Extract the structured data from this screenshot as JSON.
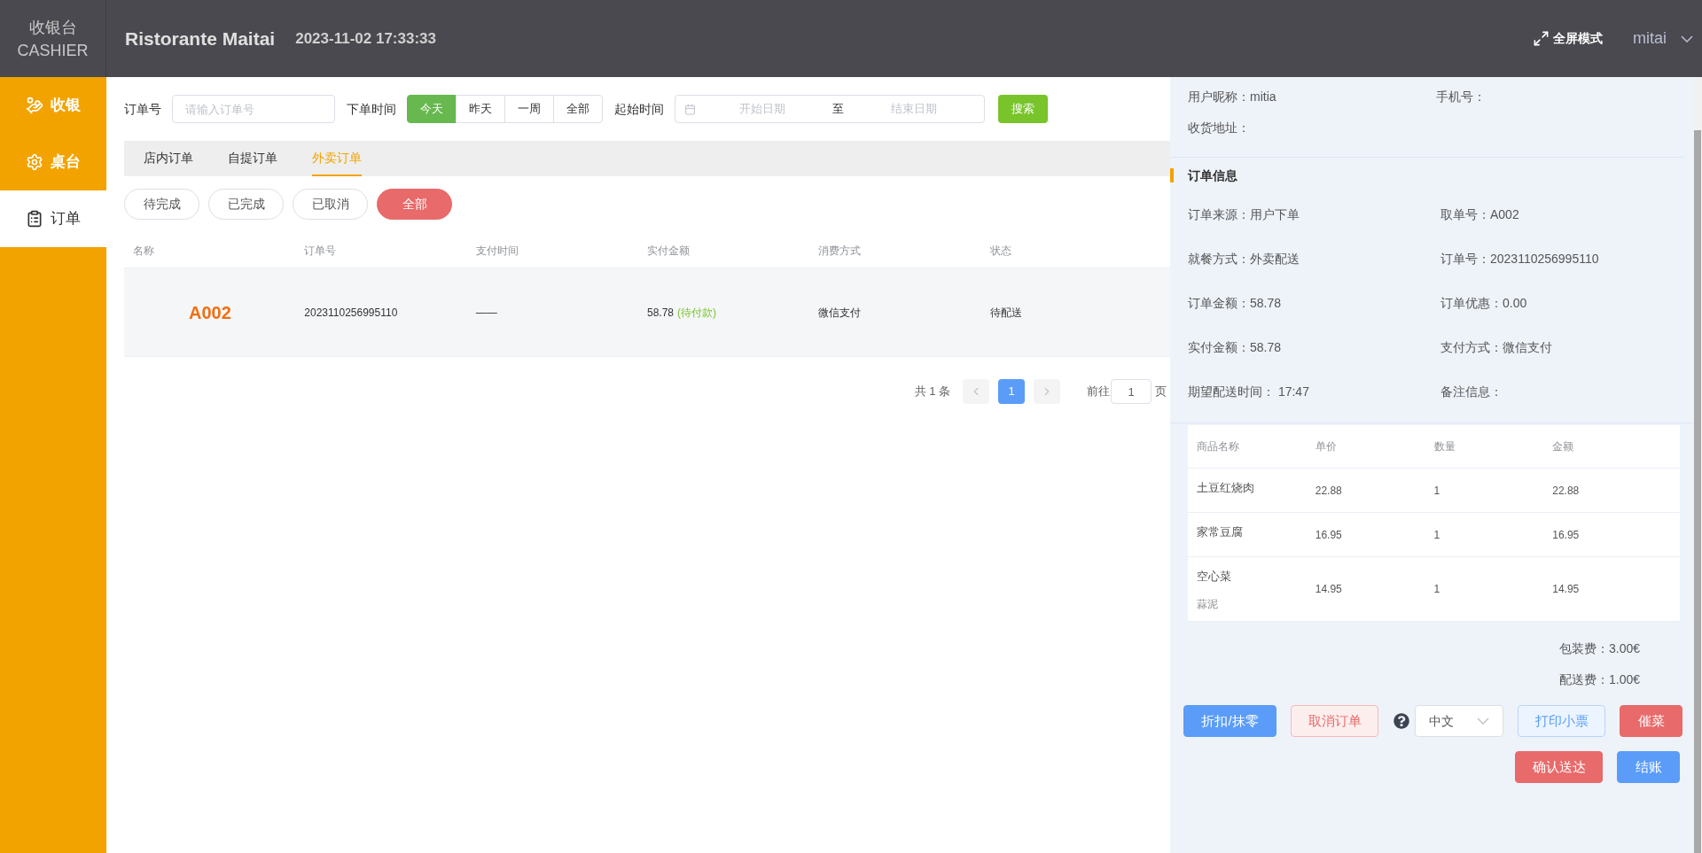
{
  "brand": {
    "title": "收银台",
    "subtitle": "CASHIER"
  },
  "header": {
    "restaurant": "Ristorante Maitai",
    "datetime": "2023-11-02 17:33:33",
    "fullscreen": "全屏模式",
    "user": "mitai"
  },
  "sidebar": {
    "items": [
      {
        "kind": "cash",
        "label": "收银",
        "selected": false
      },
      {
        "kind": "table",
        "label": "桌台",
        "selected": false
      },
      {
        "kind": "order",
        "label": "订单",
        "selected": true
      }
    ]
  },
  "filters": {
    "order_no_label": "订单号",
    "order_no_placeholder": "请输入订单号",
    "time_label": "下单时间",
    "time_options": [
      {
        "label": "今天",
        "selected": true
      },
      {
        "label": "昨天",
        "selected": false
      },
      {
        "label": "一周",
        "selected": false
      },
      {
        "label": "全部",
        "selected": false
      }
    ],
    "range_label": "起始时间",
    "start_placeholder": "开始日期",
    "range_separator": "至",
    "end_placeholder": "结束日期",
    "search": "搜索"
  },
  "tabs": [
    {
      "label": "店内订单",
      "selected": false
    },
    {
      "label": "自提订单",
      "selected": false
    },
    {
      "label": "外卖订单",
      "selected": true
    }
  ],
  "status_filters": [
    {
      "label": "待完成",
      "selected": false
    },
    {
      "label": "已完成",
      "selected": false
    },
    {
      "label": "已取消",
      "selected": false
    },
    {
      "label": "全部",
      "selected": true
    }
  ],
  "table": {
    "columns": [
      "名称",
      "订单号",
      "支付时间",
      "实付金额",
      "消费方式",
      "状态"
    ],
    "rows": [
      {
        "name": "A002",
        "order_no": "2023110256995110",
        "pay_time": "——",
        "amount": "58.78",
        "amount_note": "(待付款)",
        "method": "微信支付",
        "status": "待配送"
      }
    ]
  },
  "pagination": {
    "total": "共 1 条",
    "pages": [
      {
        "label": "1",
        "selected": true
      }
    ],
    "goto_label": "前往",
    "goto_value": "1",
    "page_suffix": "页"
  },
  "detail": {
    "customer": [
      {
        "label": "用户昵称：mitia"
      },
      {
        "label": "手机号："
      },
      {
        "label": "收货地址："
      }
    ],
    "section_title": "订单信息",
    "info": [
      "订单来源：用户下单",
      "取单号：A002",
      "就餐方式：外卖配送",
      "订单号：2023110256995110",
      "订单金额：58.78",
      "订单优惠：0.00",
      "实付金额：58.78",
      "支付方式：微信支付",
      "期望配送时间： 17:47",
      "备注信息："
    ],
    "items_table": {
      "columns": [
        "商品名称",
        "单价",
        "数量",
        "金额"
      ],
      "rows": [
        {
          "name": "土豆红烧肉",
          "price": "22.88",
          "qty": "1",
          "total": "22.88"
        },
        {
          "name": "家常豆腐",
          "price": "16.95",
          "qty": "1",
          "total": "16.95"
        },
        {
          "name": "空心菜",
          "note": "蒜泥",
          "price": "14.95",
          "qty": "1",
          "total": "14.95"
        }
      ]
    },
    "fees": [
      "包装费：3.00€",
      "配送费：1.00€"
    ],
    "language": "中文",
    "buttons": [
      {
        "label": "折扣/抹零",
        "kind": "primary"
      },
      {
        "label": "取消订单",
        "kind": "danger-plain"
      },
      {
        "label": "打印小票",
        "kind": "primary-plain"
      },
      {
        "label": "催菜",
        "kind": "danger"
      },
      {
        "label": "确认送达",
        "kind": "danger"
      },
      {
        "label": "结账",
        "kind": "primary"
      }
    ]
  }
}
